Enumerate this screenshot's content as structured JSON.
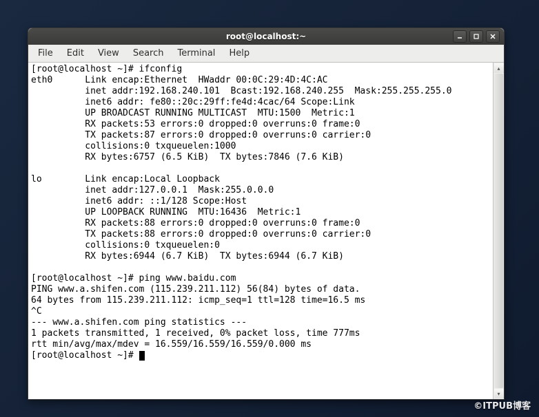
{
  "titlebar": {
    "title": "root@localhost:~"
  },
  "menubar": {
    "file": "File",
    "edit": "Edit",
    "view": "View",
    "search": "Search",
    "terminal": "Terminal",
    "help": "Help"
  },
  "terminal": {
    "lines": [
      "[root@localhost ~]# ifconfig",
      "eth0      Link encap:Ethernet  HWaddr 00:0C:29:4D:4C:AC  ",
      "          inet addr:192.168.240.101  Bcast:192.168.240.255  Mask:255.255.255.0",
      "          inet6 addr: fe80::20c:29ff:fe4d:4cac/64 Scope:Link",
      "          UP BROADCAST RUNNING MULTICAST  MTU:1500  Metric:1",
      "          RX packets:53 errors:0 dropped:0 overruns:0 frame:0",
      "          TX packets:87 errors:0 dropped:0 overruns:0 carrier:0",
      "          collisions:0 txqueuelen:1000 ",
      "          RX bytes:6757 (6.5 KiB)  TX bytes:7846 (7.6 KiB)",
      "",
      "lo        Link encap:Local Loopback  ",
      "          inet addr:127.0.0.1  Mask:255.0.0.0",
      "          inet6 addr: ::1/128 Scope:Host",
      "          UP LOOPBACK RUNNING  MTU:16436  Metric:1",
      "          RX packets:88 errors:0 dropped:0 overruns:0 frame:0",
      "          TX packets:88 errors:0 dropped:0 overruns:0 carrier:0",
      "          collisions:0 txqueuelen:0 ",
      "          RX bytes:6944 (6.7 KiB)  TX bytes:6944 (6.7 KiB)",
      "",
      "[root@localhost ~]# ping www.baidu.com",
      "PING www.a.shifen.com (115.239.211.112) 56(84) bytes of data.",
      "64 bytes from 115.239.211.112: icmp_seq=1 ttl=128 time=16.5 ms",
      "^C",
      "--- www.a.shifen.com ping statistics ---",
      "1 packets transmitted, 1 received, 0% packet loss, time 777ms",
      "rtt min/avg/max/mdev = 16.559/16.559/16.559/0.000 ms",
      "[root@localhost ~]# "
    ]
  },
  "watermark": "©ITPUB博客"
}
